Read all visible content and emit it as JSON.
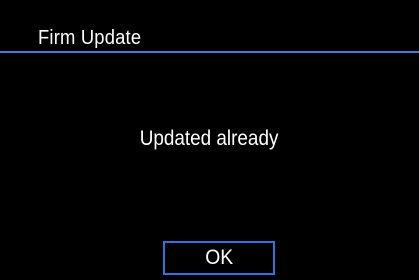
{
  "header": {
    "title": "Firm Update"
  },
  "dialog": {
    "message": "Updated already",
    "ok_label": "OK"
  },
  "colors": {
    "background": "#000000",
    "text": "#ffffff",
    "accent": "#2d73d9"
  }
}
